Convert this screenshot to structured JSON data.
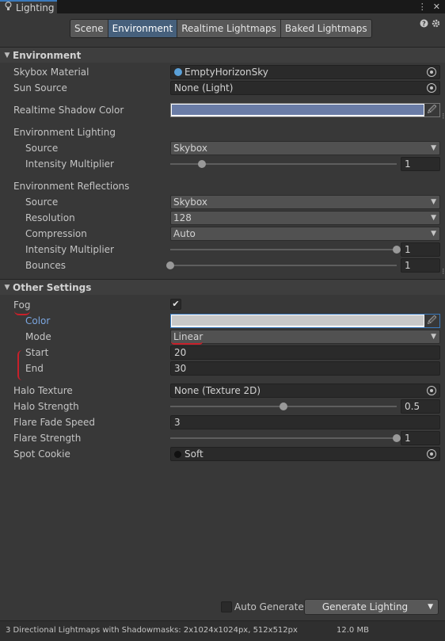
{
  "window": {
    "title": "Lighting",
    "menu_glyph": "⋮",
    "close_glyph": "✕"
  },
  "tabs": [
    "Scene",
    "Environment",
    "Realtime Lightmaps",
    "Baked Lightmaps"
  ],
  "active_tab": "Environment",
  "environment": {
    "header": "Environment",
    "skybox_material": {
      "label": "Skybox Material",
      "value": "EmptyHorizonSky"
    },
    "sun_source": {
      "label": "Sun Source",
      "value": "None (Light)"
    },
    "realtime_shadow_color": {
      "label": "Realtime Shadow Color",
      "color": "#6a7ca6"
    },
    "env_lighting": {
      "label": "Environment Lighting",
      "source": {
        "label": "Source",
        "value": "Skybox"
      },
      "intensity": {
        "label": "Intensity Multiplier",
        "value": "1",
        "fraction": 0.14
      }
    },
    "env_reflections": {
      "label": "Environment Reflections",
      "source": {
        "label": "Source",
        "value": "Skybox"
      },
      "resolution": {
        "label": "Resolution",
        "value": "128"
      },
      "compression": {
        "label": "Compression",
        "value": "Auto"
      },
      "intensity": {
        "label": "Intensity Multiplier",
        "value": "1",
        "fraction": 1.0
      },
      "bounces": {
        "label": "Bounces",
        "value": "1",
        "fraction": 0.0
      }
    }
  },
  "other": {
    "header": "Other Settings",
    "fog": {
      "label": "Fog",
      "checked": "✔"
    },
    "color": {
      "label": "Color",
      "color": "#c8c8c8"
    },
    "mode": {
      "label": "Mode",
      "value": "Linear"
    },
    "start": {
      "label": "Start",
      "value": "20"
    },
    "end": {
      "label": "End",
      "value": "30"
    },
    "halo_texture": {
      "label": "Halo Texture",
      "value": "None (Texture 2D)"
    },
    "halo_strength": {
      "label": "Halo Strength",
      "value": "0.5",
      "fraction": 0.5
    },
    "flare_fade": {
      "label": "Flare Fade Speed",
      "value": "3"
    },
    "flare_strength": {
      "label": "Flare Strength",
      "value": "1",
      "fraction": 1.0
    },
    "spot_cookie": {
      "label": "Spot Cookie",
      "value": "Soft"
    }
  },
  "footer": {
    "auto_generate": "Auto Generate",
    "generate": "Generate Lighting",
    "status": "3 Directional Lightmaps with Shadowmasks: 2x1024x1024px, 512x512px",
    "size": "12.0 MB"
  },
  "colors": {
    "accent": "#46607c",
    "annotation": "#c8202a",
    "panel": "#383838"
  }
}
